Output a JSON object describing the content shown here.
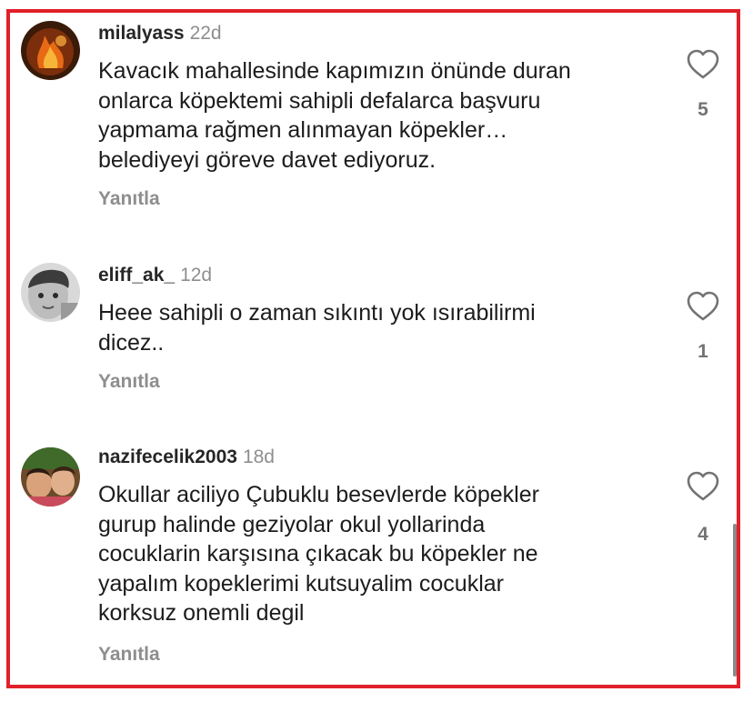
{
  "colors": {
    "frame_border": "#e0202a",
    "text": "#1c1c1c",
    "muted": "#8e8e8e"
  },
  "comments": [
    {
      "username": "milalyass",
      "age": "22d",
      "text": "Kavacık mahallesinde kapımızın  önünde duran\nonlarca köpektemi sahipli defalarca başvuru\nyapmama rağmen alınmayan köpekler…\nbelediyeyi göreve davet ediyoruz.",
      "reply_label": "Yanıtla",
      "like_icon": "heart-outline-icon",
      "likes": "5",
      "avatar_icon": "fire-avatar"
    },
    {
      "username": "eliff_ak_",
      "age": "12d",
      "text": "Heee sahipli o zaman sıkıntı yok ısırabilirmi\ndicez..",
      "reply_label": "Yanıtla",
      "like_icon": "heart-outline-icon",
      "likes": "1",
      "avatar_icon": "child-photo-avatar"
    },
    {
      "username": "nazifecelik2003",
      "age": "18d",
      "text": "Okullar aciliyo Çubuklu besevlerde köpekler\ngurup halinde geziyolar okul yollarinda\ncocuklarin karşısına çıkacak bu köpekler ne\nyapalım kopeklerimi kutsuyalim cocuklar\nkorksuz onemli degil",
      "reply_label": "Yanıtla",
      "like_icon": "heart-outline-icon",
      "likes": "4",
      "avatar_icon": "group-photo-avatar"
    }
  ]
}
